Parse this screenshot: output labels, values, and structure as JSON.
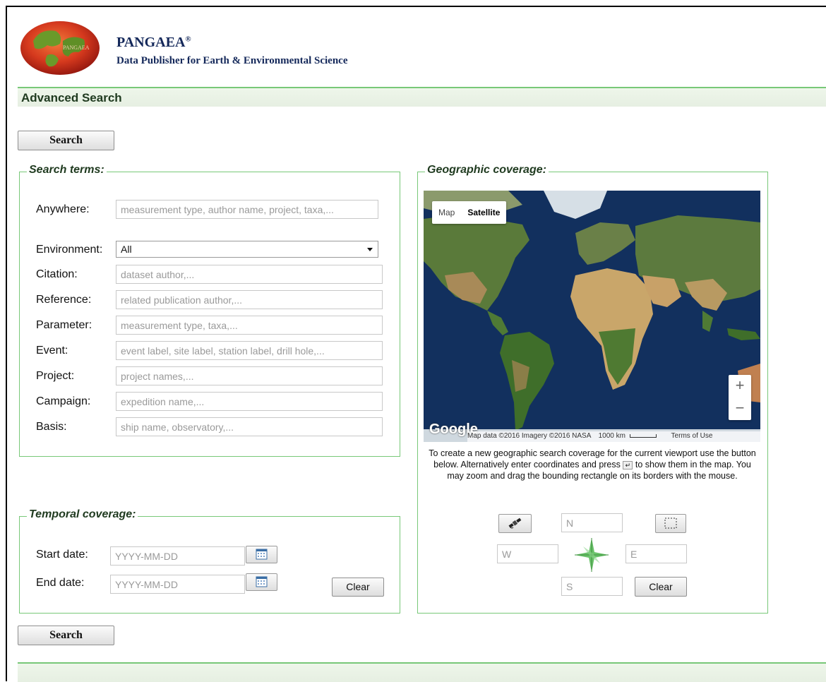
{
  "brand": {
    "title": "PANGAEA",
    "registered": "®",
    "subtitle": "Data Publisher for Earth & Environmental Science",
    "logo_text": "PANGAEA"
  },
  "page": {
    "section_title": "Advanced Search"
  },
  "buttons": {
    "search": "Search",
    "clear": "Clear"
  },
  "search_terms": {
    "legend": "Search terms:",
    "fields": [
      {
        "label": "Anywhere:",
        "placeholder": "measurement type, author name, project, taxa,..."
      },
      {
        "label": "Environment:",
        "value": "All"
      },
      {
        "label": "Citation:",
        "placeholder": "dataset author,..."
      },
      {
        "label": "Reference:",
        "placeholder": "related publication author,..."
      },
      {
        "label": "Parameter:",
        "placeholder": "measurement type, taxa,..."
      },
      {
        "label": "Event:",
        "placeholder": "event label, site label, station label, drill hole,..."
      },
      {
        "label": "Project:",
        "placeholder": "project names,..."
      },
      {
        "label": "Campaign:",
        "placeholder": "expedition name,..."
      },
      {
        "label": "Basis:",
        "placeholder": "ship name, observatory,..."
      }
    ]
  },
  "temporal": {
    "legend": "Temporal coverage:",
    "start_label": "Start date:",
    "end_label": "End date:",
    "start_placeholder": "YYYY-MM-DD",
    "end_placeholder": "YYYY-MM-DD"
  },
  "geo": {
    "legend": "Geographic coverage:",
    "map_type_map": "Map",
    "map_type_satellite": "Satellite",
    "google": "Google",
    "attribution": "Map data ©2016 Imagery ©2016 NASA",
    "scale": "1000 km",
    "terms": "Terms of Use",
    "zoom_in": "+",
    "zoom_out": "−",
    "help_1": "To create a new geographic search coverage for the current viewport use the button below. Alternatively enter coordinates and press",
    "help_2": "to show them in the map. You may zoom and drag the bounding rectangle on its borders with the mouse.",
    "north": "N",
    "south": "S",
    "west": "W",
    "east": "E"
  },
  "colors": {
    "accent_green": "#78c878",
    "brand_navy": "#14285a"
  }
}
